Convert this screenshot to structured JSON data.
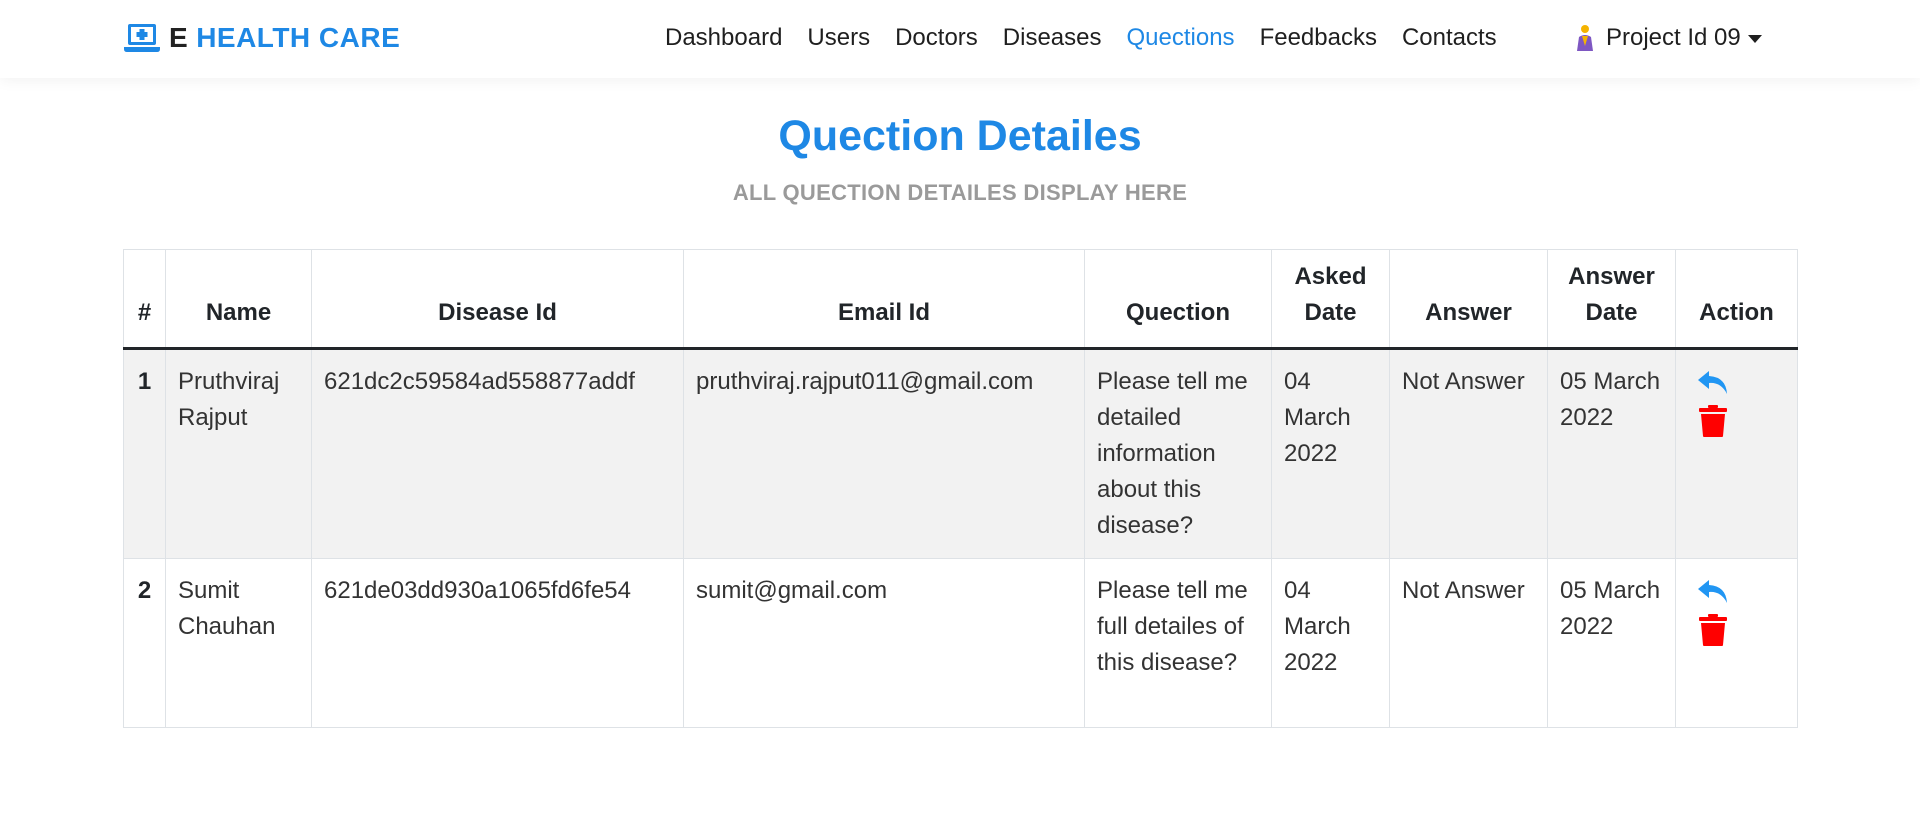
{
  "brand": {
    "prefix": "E",
    "name": "HEALTH CARE"
  },
  "nav": {
    "items": [
      {
        "label": "Dashboard",
        "active": false
      },
      {
        "label": "Users",
        "active": false
      },
      {
        "label": "Doctors",
        "active": false
      },
      {
        "label": "Diseases",
        "active": false
      },
      {
        "label": "Quections",
        "active": true
      },
      {
        "label": "Feedbacks",
        "active": false
      },
      {
        "label": "Contacts",
        "active": false
      }
    ],
    "project": "Project Id 09"
  },
  "page": {
    "title": "Quection Detailes",
    "subtitle": "ALL QUECTION DETAILES DISPLAY HERE"
  },
  "table": {
    "headers": [
      "#",
      "Name",
      "Disease Id",
      "Email Id",
      "Quection",
      "Asked Date",
      "Answer",
      "Answer Date",
      "Action"
    ],
    "rows": [
      {
        "num": "1",
        "name": "Pruthviraj Rajput",
        "disease_id": "621dc2c59584ad558877addf",
        "email": "pruthviraj.rajput011@gmail.com",
        "question": "Please tell me detailed information about this disease?",
        "asked_date": "04 March 2022",
        "answer": "Not Answer",
        "answer_date": "05 March 2022"
      },
      {
        "num": "2",
        "name": "Sumit Chauhan",
        "disease_id": "621de03dd930a1065fd6fe54",
        "email": "sumit@gmail.com",
        "question": "Please tell me full detailes of this disease?",
        "asked_date": "04 March 2022",
        "answer": "Not Answer",
        "answer_date": "05 March 2022"
      }
    ]
  },
  "icons": {
    "brand": "laptop-medical-icon",
    "project": "user-avatar-icon",
    "reply": "reply-icon",
    "delete": "trash-icon"
  },
  "colors": {
    "accent": "#1e88e5",
    "reply_icon": "#2196f3",
    "delete_icon": "#ff0000",
    "subtitle": "#9a9a9a",
    "striped_row": "#f2f2f2"
  }
}
